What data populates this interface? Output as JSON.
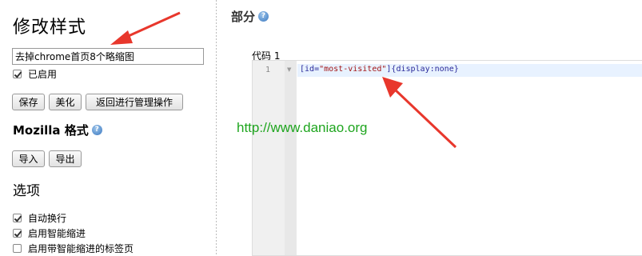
{
  "left_panel": {
    "title": "修改样式",
    "style_name_value": "去掉chrome首页8个略缩图",
    "enabled_label": "已启用",
    "enabled_checked": true,
    "buttons": {
      "save": "保存",
      "beautify": "美化",
      "back": "返回进行管理操作"
    },
    "mozilla_heading": "Mozilla 格式",
    "import_label": "导入",
    "export_label": "导出",
    "options_heading": "选项",
    "options": [
      {
        "label": "自动换行",
        "checked": true
      },
      {
        "label": "启用智能缩进",
        "checked": true
      },
      {
        "label": "启用带智能缩进的标签页",
        "checked": false
      }
    ]
  },
  "main": {
    "section_title": "部分",
    "code_label": "代码 1",
    "editor": {
      "line_number": "1",
      "tokens": {
        "open_bracket": "[",
        "attr": "id=",
        "string": "\"most-visited\"",
        "close_bracket": "]",
        "open_brace": "{",
        "prop": "display",
        "colon": ":",
        "value": "none",
        "close_brace": "}"
      }
    },
    "watermark": "http://www.daniao.org"
  },
  "icons": {
    "help": "help-icon",
    "fold": "fold-triangle-icon",
    "annotation_arrows": "red-arrow-icon"
  },
  "colors": {
    "arrow": "#e8372c",
    "watermark": "#1ea51e",
    "active_line": "#e8f2ff"
  }
}
